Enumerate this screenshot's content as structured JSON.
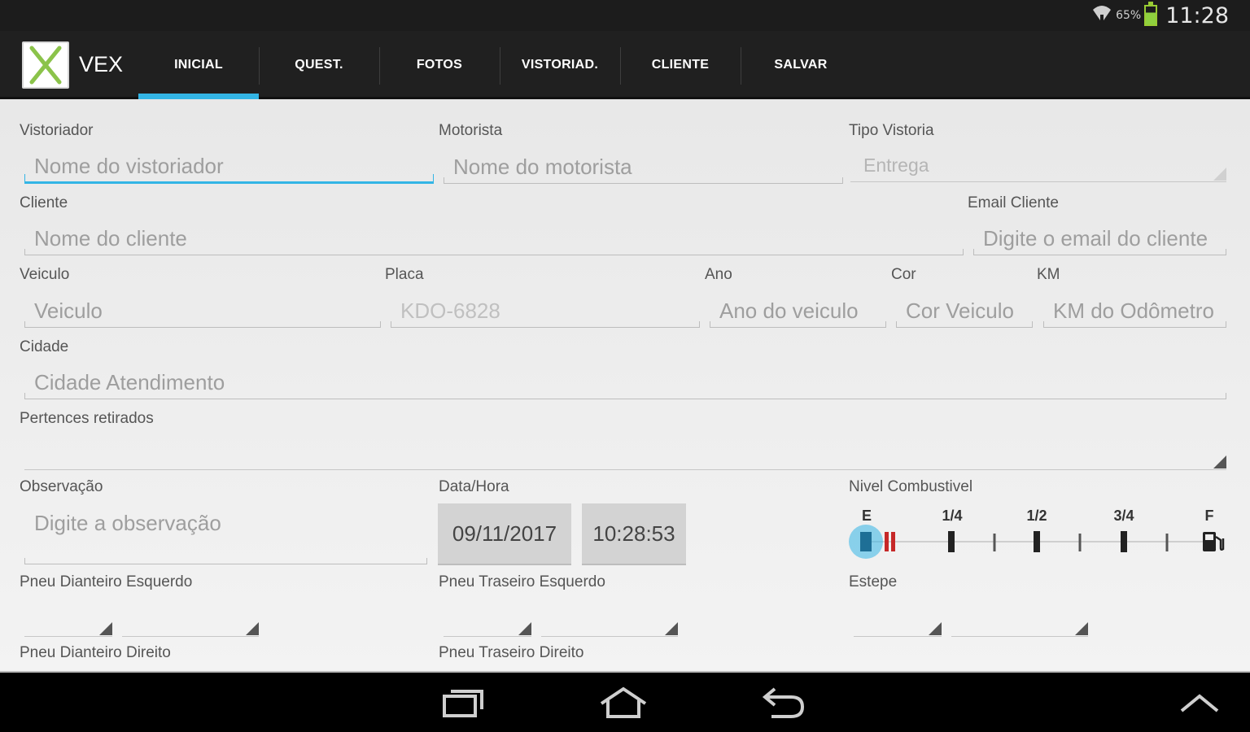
{
  "status": {
    "battery_pct": "65%",
    "clock": "11:28"
  },
  "app": {
    "name": "VEX"
  },
  "tabs": [
    {
      "label": "INICIAL"
    },
    {
      "label": "QUEST."
    },
    {
      "label": "FOTOS"
    },
    {
      "label": "VISTORIAD."
    },
    {
      "label": "CLIENTE"
    },
    {
      "label": "SALVAR"
    }
  ],
  "form": {
    "vistoriador": {
      "label": "Vistoriador",
      "placeholder": "Nome do vistoriador"
    },
    "motorista": {
      "label": "Motorista",
      "placeholder": "Nome do motorista"
    },
    "tipo_vistoria": {
      "label": "Tipo Vistoria",
      "value": "Entrega"
    },
    "cliente": {
      "label": "Cliente",
      "placeholder": "Nome do cliente"
    },
    "email_cliente": {
      "label": "Email Cliente",
      "placeholder": "Digite o email do cliente"
    },
    "veiculo": {
      "label": "Veiculo",
      "placeholder": "Veiculo"
    },
    "placa": {
      "label": "Placa",
      "value": "KDO-6828"
    },
    "ano": {
      "label": "Ano",
      "placeholder": "Ano do veiculo"
    },
    "cor": {
      "label": "Cor",
      "placeholder": "Cor Veiculo"
    },
    "km": {
      "label": "KM",
      "placeholder": "KM do Odômetro"
    },
    "cidade": {
      "label": "Cidade",
      "placeholder": "Cidade Atendimento"
    },
    "pertences": {
      "label": "Pertences retirados"
    },
    "observacao": {
      "label": "Observação",
      "placeholder": "Digite a observação"
    },
    "data_hora": {
      "label": "Data/Hora",
      "date": "09/11/2017",
      "time": "10:28:53"
    },
    "nivel_combustivel": {
      "label": "Nivel Combustivel",
      "marks": [
        "E",
        "1/4",
        "1/2",
        "3/4",
        "F"
      ],
      "level": 0
    },
    "pneu_dianteiro_esquerdo": {
      "label": "Pneu Dianteiro Esquerdo"
    },
    "pneu_traseiro_esquerdo": {
      "label": "Pneu Traseiro Esquerdo"
    },
    "estepe": {
      "label": "Estepe"
    },
    "pneu_dianteiro_direito": {
      "label": "Pneu Dianteiro Direito"
    },
    "pneu_traseiro_direito": {
      "label": "Pneu Traseiro Direito"
    }
  },
  "icons": {
    "logo": "x-logo-icon",
    "back": "back-icon",
    "home": "home-icon",
    "recents": "recent-apps-icon",
    "up": "chevron-up-icon",
    "fuel": "fuel-pump-icon"
  },
  "colors": {
    "accent": "#33b5e5",
    "logo_green": "#8bc34a"
  }
}
